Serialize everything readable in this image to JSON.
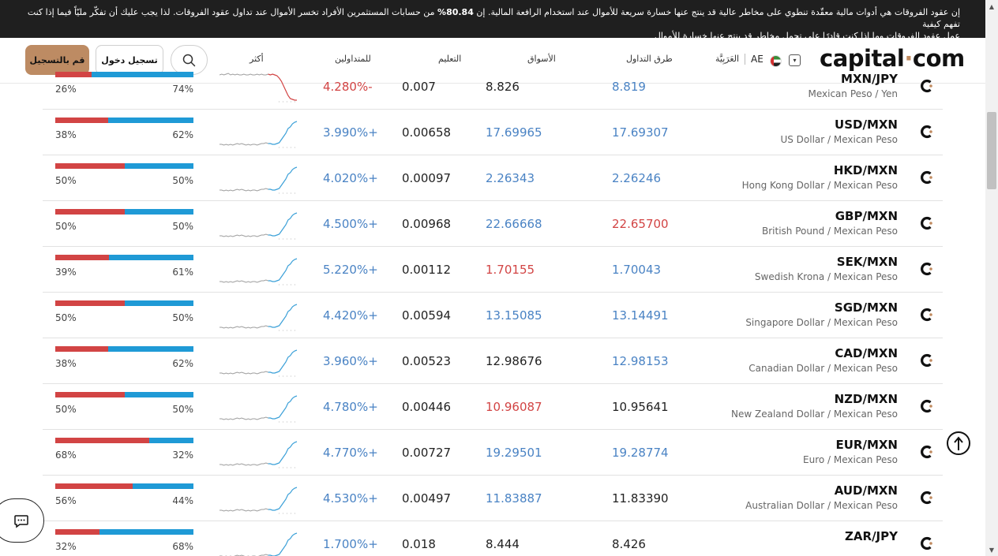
{
  "banner": {
    "line1_a": "إن عقود الفروقات هي أدوات مالية معقّدة تنطوي على مخاطر عالية قد ينتج عنها خسارة سريعة للأموال عند استخدام الرافعة المالية. إن ",
    "line1_pct": "80.84%",
    "line1_b": " من حسابات المستثمرين الأفراد تخسر الأموال عند تداول عقود الفروقات. لذا يجب عليك أن تفكّر مليّاً فيما إذا كنت تفهم كيفية",
    "line2": "عمل عقود الفروقات وما إذا كنت قادرًا على تحمل مخاطر قد ينتج عنها خسارة للأموال"
  },
  "header": {
    "logo_a": "capital",
    "logo_dot": "·",
    "logo_b": "com",
    "nav": [
      "طرق التداول",
      "الأسواق",
      "التعليم",
      "للمتداولين",
      "أكثر"
    ],
    "language": "العَرَبِيَّة",
    "country": "AE",
    "login_label": "تسجيل دخول",
    "signup_label": "قم بالتسجيل"
  },
  "colors": {
    "sell": "#d24444",
    "buy": "#1f9ad6",
    "accent": "#bd8b63",
    "up": "#4a83c4",
    "down": "#d24444",
    "spark_old": "#9e9e9e",
    "spark_new": "#3ba0d8"
  },
  "rows": [
    {
      "pair": "MXN/JPY",
      "name": "Mexican Peso / Yen",
      "sell_pct": 26,
      "sell_label": "26%",
      "buy_label": "74%",
      "change": "4.280%-",
      "change_dir": "down",
      "spread": "0.007",
      "sell": "8.826",
      "sell_color": "dark",
      "buy": "8.819",
      "buy_color": "blue",
      "trend": "down"
    },
    {
      "pair": "USD/MXN",
      "name": "US Dollar / Mexican Peso",
      "sell_pct": 38,
      "sell_label": "38%",
      "buy_label": "62%",
      "change": "3.990%+",
      "change_dir": "up",
      "spread": "0.00658",
      "sell": "17.69965",
      "sell_color": "blue",
      "buy": "17.69307",
      "buy_color": "blue",
      "trend": "up"
    },
    {
      "pair": "HKD/MXN",
      "name": "Hong Kong Dollar / Mexican Peso",
      "sell_pct": 50,
      "sell_label": "50%",
      "buy_label": "50%",
      "change": "4.020%+",
      "change_dir": "up",
      "spread": "0.00097",
      "sell": "2.26343",
      "sell_color": "blue",
      "buy": "2.26246",
      "buy_color": "blue",
      "trend": "up"
    },
    {
      "pair": "GBP/MXN",
      "name": "British Pound / Mexican Peso",
      "sell_pct": 50,
      "sell_label": "50%",
      "buy_label": "50%",
      "change": "4.500%+",
      "change_dir": "up",
      "spread": "0.00968",
      "sell": "22.66668",
      "sell_color": "blue",
      "buy": "22.65700",
      "buy_color": "red",
      "trend": "up"
    },
    {
      "pair": "SEK/MXN",
      "name": "Swedish Krona / Mexican Peso",
      "sell_pct": 39,
      "sell_label": "39%",
      "buy_label": "61%",
      "change": "5.220%+",
      "change_dir": "up",
      "spread": "0.00112",
      "sell": "1.70155",
      "sell_color": "red",
      "buy": "1.70043",
      "buy_color": "blue",
      "trend": "up"
    },
    {
      "pair": "SGD/MXN",
      "name": "Singapore Dollar / Mexican Peso",
      "sell_pct": 50,
      "sell_label": "50%",
      "buy_label": "50%",
      "change": "4.420%+",
      "change_dir": "up",
      "spread": "0.00594",
      "sell": "13.15085",
      "sell_color": "blue",
      "buy": "13.14491",
      "buy_color": "blue",
      "trend": "up"
    },
    {
      "pair": "CAD/MXN",
      "name": "Canadian Dollar / Mexican Peso",
      "sell_pct": 38,
      "sell_label": "38%",
      "buy_label": "62%",
      "change": "3.960%+",
      "change_dir": "up",
      "spread": "0.00523",
      "sell": "12.98676",
      "sell_color": "dark",
      "buy": "12.98153",
      "buy_color": "blue",
      "trend": "up"
    },
    {
      "pair": "NZD/MXN",
      "name": "New Zealand Dollar / Mexican Peso",
      "sell_pct": 50,
      "sell_label": "50%",
      "buy_label": "50%",
      "change": "4.780%+",
      "change_dir": "up",
      "spread": "0.00446",
      "sell": "10.96087",
      "sell_color": "red",
      "buy": "10.95641",
      "buy_color": "dark",
      "trend": "up"
    },
    {
      "pair": "EUR/MXN",
      "name": "Euro / Mexican Peso",
      "sell_pct": 68,
      "sell_label": "68%",
      "buy_label": "32%",
      "change": "4.770%+",
      "change_dir": "up",
      "spread": "0.00727",
      "sell": "19.29501",
      "sell_color": "blue",
      "buy": "19.28774",
      "buy_color": "blue",
      "trend": "up"
    },
    {
      "pair": "AUD/MXN",
      "name": "Australian Dollar / Mexican Peso",
      "sell_pct": 56,
      "sell_label": "56%",
      "buy_label": "44%",
      "change": "4.530%+",
      "change_dir": "up",
      "spread": "0.00497",
      "sell": "11.83887",
      "sell_color": "blue",
      "buy": "11.83390",
      "buy_color": "dark",
      "trend": "up"
    },
    {
      "pair": "ZAR/JPY",
      "name": "",
      "sell_pct": 32,
      "sell_label": "32%",
      "buy_label": "68%",
      "change": "1.700%+",
      "change_dir": "up",
      "spread": "0.018",
      "sell": "8.444",
      "sell_color": "dark",
      "buy": "8.426",
      "buy_color": "dark",
      "trend": "up"
    }
  ]
}
